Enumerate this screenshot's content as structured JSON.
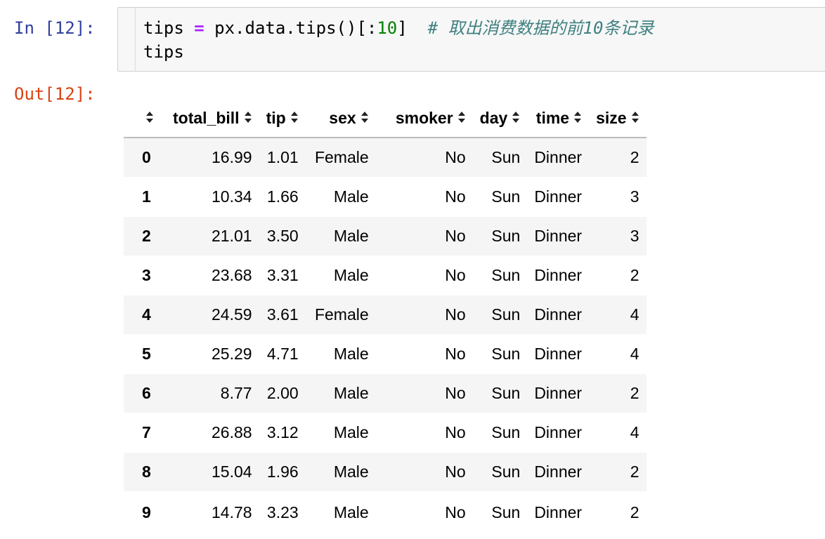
{
  "notebook": {
    "in_prompt": "In [12]:",
    "out_prompt": "Out[12]:",
    "code": {
      "line1_a": "tips ",
      "line1_op": "=",
      "line1_b": " px.data.tips()[:",
      "line1_num": "10",
      "line1_c": "]  ",
      "line1_comment": "# 取出消费数据的前10条记录",
      "line2": "tips"
    }
  },
  "table": {
    "columns": [
      "total_bill",
      "tip",
      "sex",
      "smoker",
      "day",
      "time",
      "size"
    ],
    "rows": [
      {
        "index": "0",
        "cells": [
          "16.99",
          "1.01",
          "Female",
          "No",
          "Sun",
          "Dinner",
          "2"
        ]
      },
      {
        "index": "1",
        "cells": [
          "10.34",
          "1.66",
          "Male",
          "No",
          "Sun",
          "Dinner",
          "3"
        ]
      },
      {
        "index": "2",
        "cells": [
          "21.01",
          "3.50",
          "Male",
          "No",
          "Sun",
          "Dinner",
          "3"
        ]
      },
      {
        "index": "3",
        "cells": [
          "23.68",
          "3.31",
          "Male",
          "No",
          "Sun",
          "Dinner",
          "2"
        ]
      },
      {
        "index": "4",
        "cells": [
          "24.59",
          "3.61",
          "Female",
          "No",
          "Sun",
          "Dinner",
          "4"
        ]
      },
      {
        "index": "5",
        "cells": [
          "25.29",
          "4.71",
          "Male",
          "No",
          "Sun",
          "Dinner",
          "4"
        ]
      },
      {
        "index": "6",
        "cells": [
          "8.77",
          "2.00",
          "Male",
          "No",
          "Sun",
          "Dinner",
          "2"
        ]
      },
      {
        "index": "7",
        "cells": [
          "26.88",
          "3.12",
          "Male",
          "No",
          "Sun",
          "Dinner",
          "4"
        ]
      },
      {
        "index": "8",
        "cells": [
          "15.04",
          "1.96",
          "Male",
          "No",
          "Sun",
          "Dinner",
          "2"
        ]
      },
      {
        "index": "9",
        "cells": [
          "14.78",
          "3.23",
          "Male",
          "No",
          "Sun",
          "Dinner",
          "2"
        ]
      }
    ]
  },
  "icons": {
    "sort": "sort-both-icon"
  },
  "colors": {
    "in_prompt": "#303f9f",
    "out_prompt": "#d84315",
    "operator": "#aa22ff",
    "number": "#008000",
    "comment": "#408080",
    "row_stripe": "#f5f5f5"
  }
}
